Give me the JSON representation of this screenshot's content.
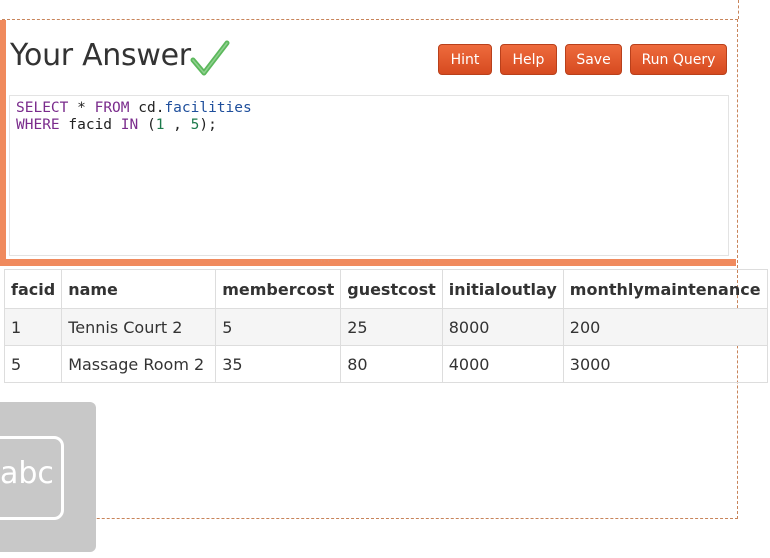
{
  "title": "Your Answer",
  "buttons": {
    "hint": "Hint",
    "help": "Help",
    "save": "Save",
    "run_query": "Run Query"
  },
  "editor": {
    "line1": {
      "kw1": "SELECT",
      "star": " * ",
      "kw2": "FROM",
      "schema": " cd.",
      "table": "facilities"
    },
    "line2": {
      "kw1": "WHERE",
      "col": " facid ",
      "kw2": "IN",
      "open": " (",
      "n1": "1",
      "sep": " , ",
      "n2": "5",
      "close": ");"
    }
  },
  "results": {
    "columns": [
      "facid",
      "name",
      "membercost",
      "guestcost",
      "initialoutlay",
      "monthlymaintenance"
    ],
    "rows": [
      [
        "1",
        "Tennis Court 2",
        "5",
        "25",
        "8000",
        "200"
      ],
      [
        "5",
        "Massage Room 2",
        "35",
        "80",
        "4000",
        "3000"
      ]
    ]
  },
  "tile_label": "abc",
  "colors": {
    "accent": "#e2562b",
    "divider": "#f08a5d",
    "check": "#5cb85c"
  },
  "icons": {
    "check": "checkmark-icon",
    "tile": "text-input-icon"
  }
}
